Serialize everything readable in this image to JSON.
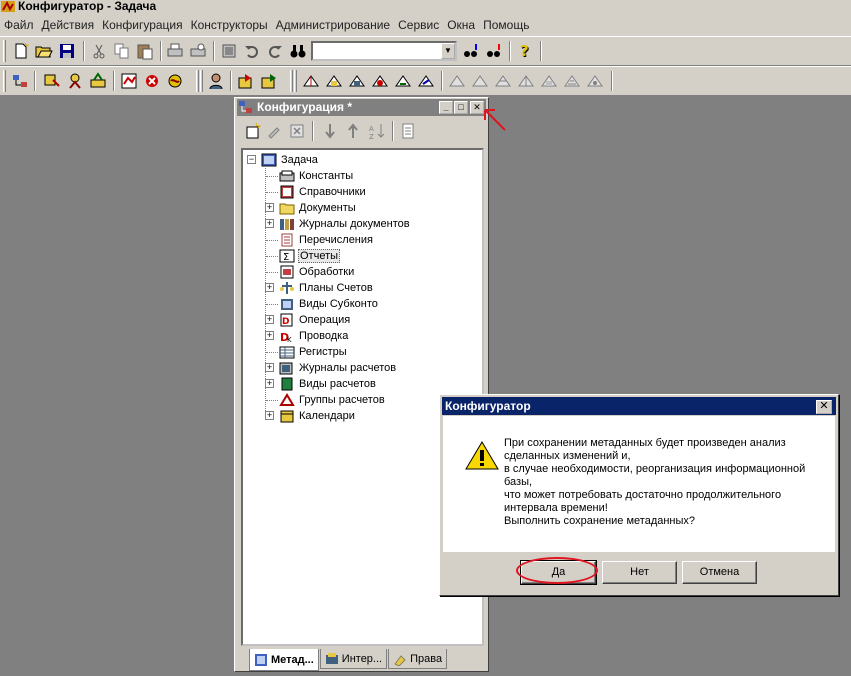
{
  "window": {
    "title": "Конфигуратор - Задача"
  },
  "menu": [
    "Файл",
    "Действия",
    "Конфигурация",
    "Конструкторы",
    "Администрирование",
    "Сервис",
    "Окна",
    "Помощь"
  ],
  "toolbar": {
    "search_value": ""
  },
  "config_panel": {
    "title": "Конфигурация *",
    "root": "Задача",
    "items": [
      {
        "label": "Константы",
        "icon": "constants-icon",
        "expandable": false
      },
      {
        "label": "Справочники",
        "icon": "catalogs-icon",
        "expandable": false
      },
      {
        "label": "Документы",
        "icon": "folder-icon",
        "expandable": true
      },
      {
        "label": "Журналы документов",
        "icon": "journals-icon",
        "expandable": true
      },
      {
        "label": "Перечисления",
        "icon": "enumerations-icon",
        "expandable": false
      },
      {
        "label": "Отчеты",
        "icon": "sigma-icon",
        "expandable": false,
        "selected": true
      },
      {
        "label": "Обработки",
        "icon": "processing-icon",
        "expandable": false
      },
      {
        "label": "Планы Счетов",
        "icon": "accounts-icon",
        "expandable": true
      },
      {
        "label": "Виды Субконто",
        "icon": "subconto-icon",
        "expandable": false
      },
      {
        "label": "Операция",
        "icon": "operation-icon",
        "expandable": true
      },
      {
        "label": "Проводка",
        "icon": "entry-icon",
        "expandable": true
      },
      {
        "label": "Регистры",
        "icon": "registers-icon",
        "expandable": false
      },
      {
        "label": "Журналы расчетов",
        "icon": "calc-journals-icon",
        "expandable": true
      },
      {
        "label": "Виды расчетов",
        "icon": "calc-kinds-icon",
        "expandable": true
      },
      {
        "label": "Группы расчетов",
        "icon": "calc-groups-icon",
        "expandable": false
      },
      {
        "label": "Календари",
        "icon": "calendar-icon",
        "expandable": true
      }
    ],
    "tabs": [
      "Метад...",
      "Интер...",
      "Права"
    ]
  },
  "dialog": {
    "title": "Конфигуратор",
    "message_lines": [
      "При сохранении метаданных будет произведен анализ",
      "сделанных  изменений и,",
      "в случае необходимости, реорганизация информационной",
      "базы,",
      "что может потребовать  достаточно продолжительного",
      "интервала времени!",
      "Выполнить сохранение метаданных?"
    ],
    "buttons": {
      "yes": "Да",
      "no": "Нет",
      "cancel": "Отмена"
    }
  },
  "colors": {
    "desktop": "#808080",
    "dialog_title": "#0a246a",
    "annotation": "#e0141e"
  }
}
